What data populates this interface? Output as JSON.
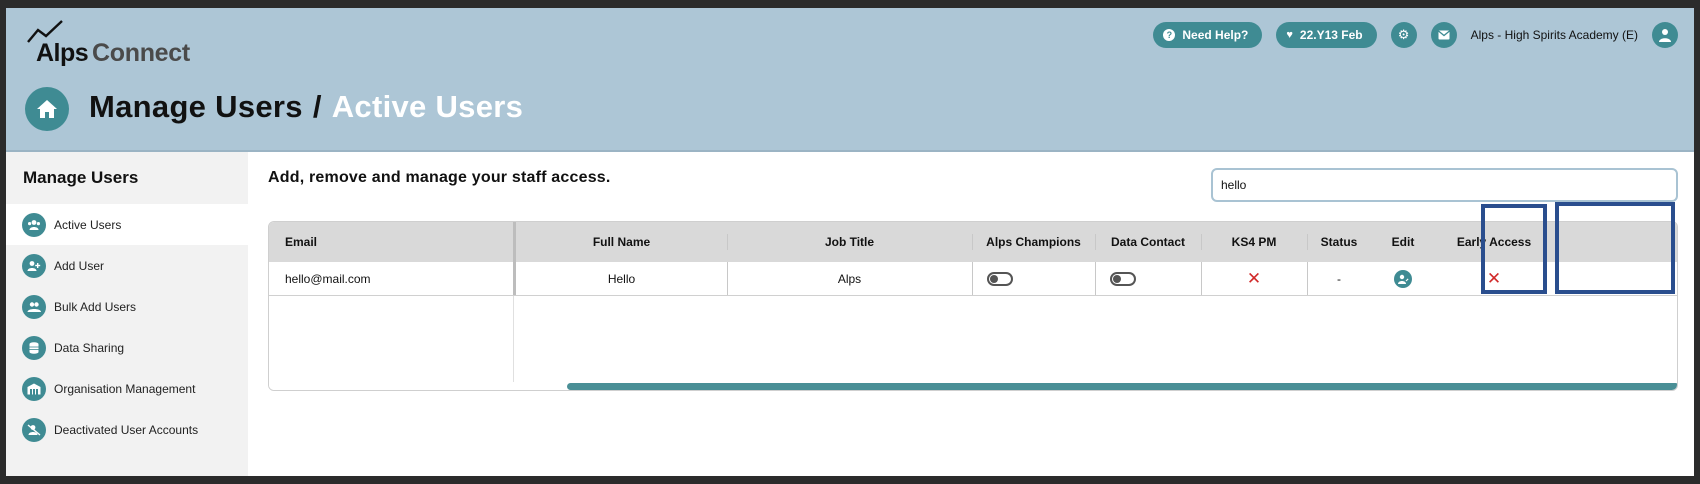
{
  "brand": {
    "alps": "Alps",
    "connect": "Connect"
  },
  "top_actions": {
    "help_label": "Need Help?",
    "badge_label": "22.Y13 Feb",
    "school_label": "Alps - High Spirits Academy (E)"
  },
  "breadcrumb": {
    "root": "Manage Users",
    "separator": "/",
    "current": "Active Users"
  },
  "sidebar": {
    "title": "Manage Users",
    "items": [
      {
        "label": "Active Users",
        "icon": "users-icon"
      },
      {
        "label": "Add User",
        "icon": "add-user-icon"
      },
      {
        "label": "Bulk Add Users",
        "icon": "bulk-users-icon"
      },
      {
        "label": "Data Sharing",
        "icon": "database-icon"
      },
      {
        "label": "Organisation Management",
        "icon": "building-icon"
      },
      {
        "label": "Deactivated User Accounts",
        "icon": "deactivated-users-icon"
      }
    ]
  },
  "main": {
    "heading": "Add, remove and manage your staff access.",
    "search_value": "hello"
  },
  "table": {
    "columns": [
      "Email",
      "Full Name",
      "Job Title",
      "Alps Champions",
      "Data Contact",
      "KS4 PM",
      "Status",
      "Edit",
      "Early Access"
    ],
    "rows": [
      {
        "email": "hello@mail.com",
        "full_name": "Hello",
        "job_title": "Alps",
        "alps_champion": false,
        "data_contact": false,
        "ks4_pm": "no",
        "status": "-",
        "early_access": "no"
      }
    ]
  },
  "colors": {
    "accent": "#3f8b93",
    "header_bg": "#adc6d6",
    "highlight": "#2a4e8e",
    "cross": "#d12a2a"
  }
}
